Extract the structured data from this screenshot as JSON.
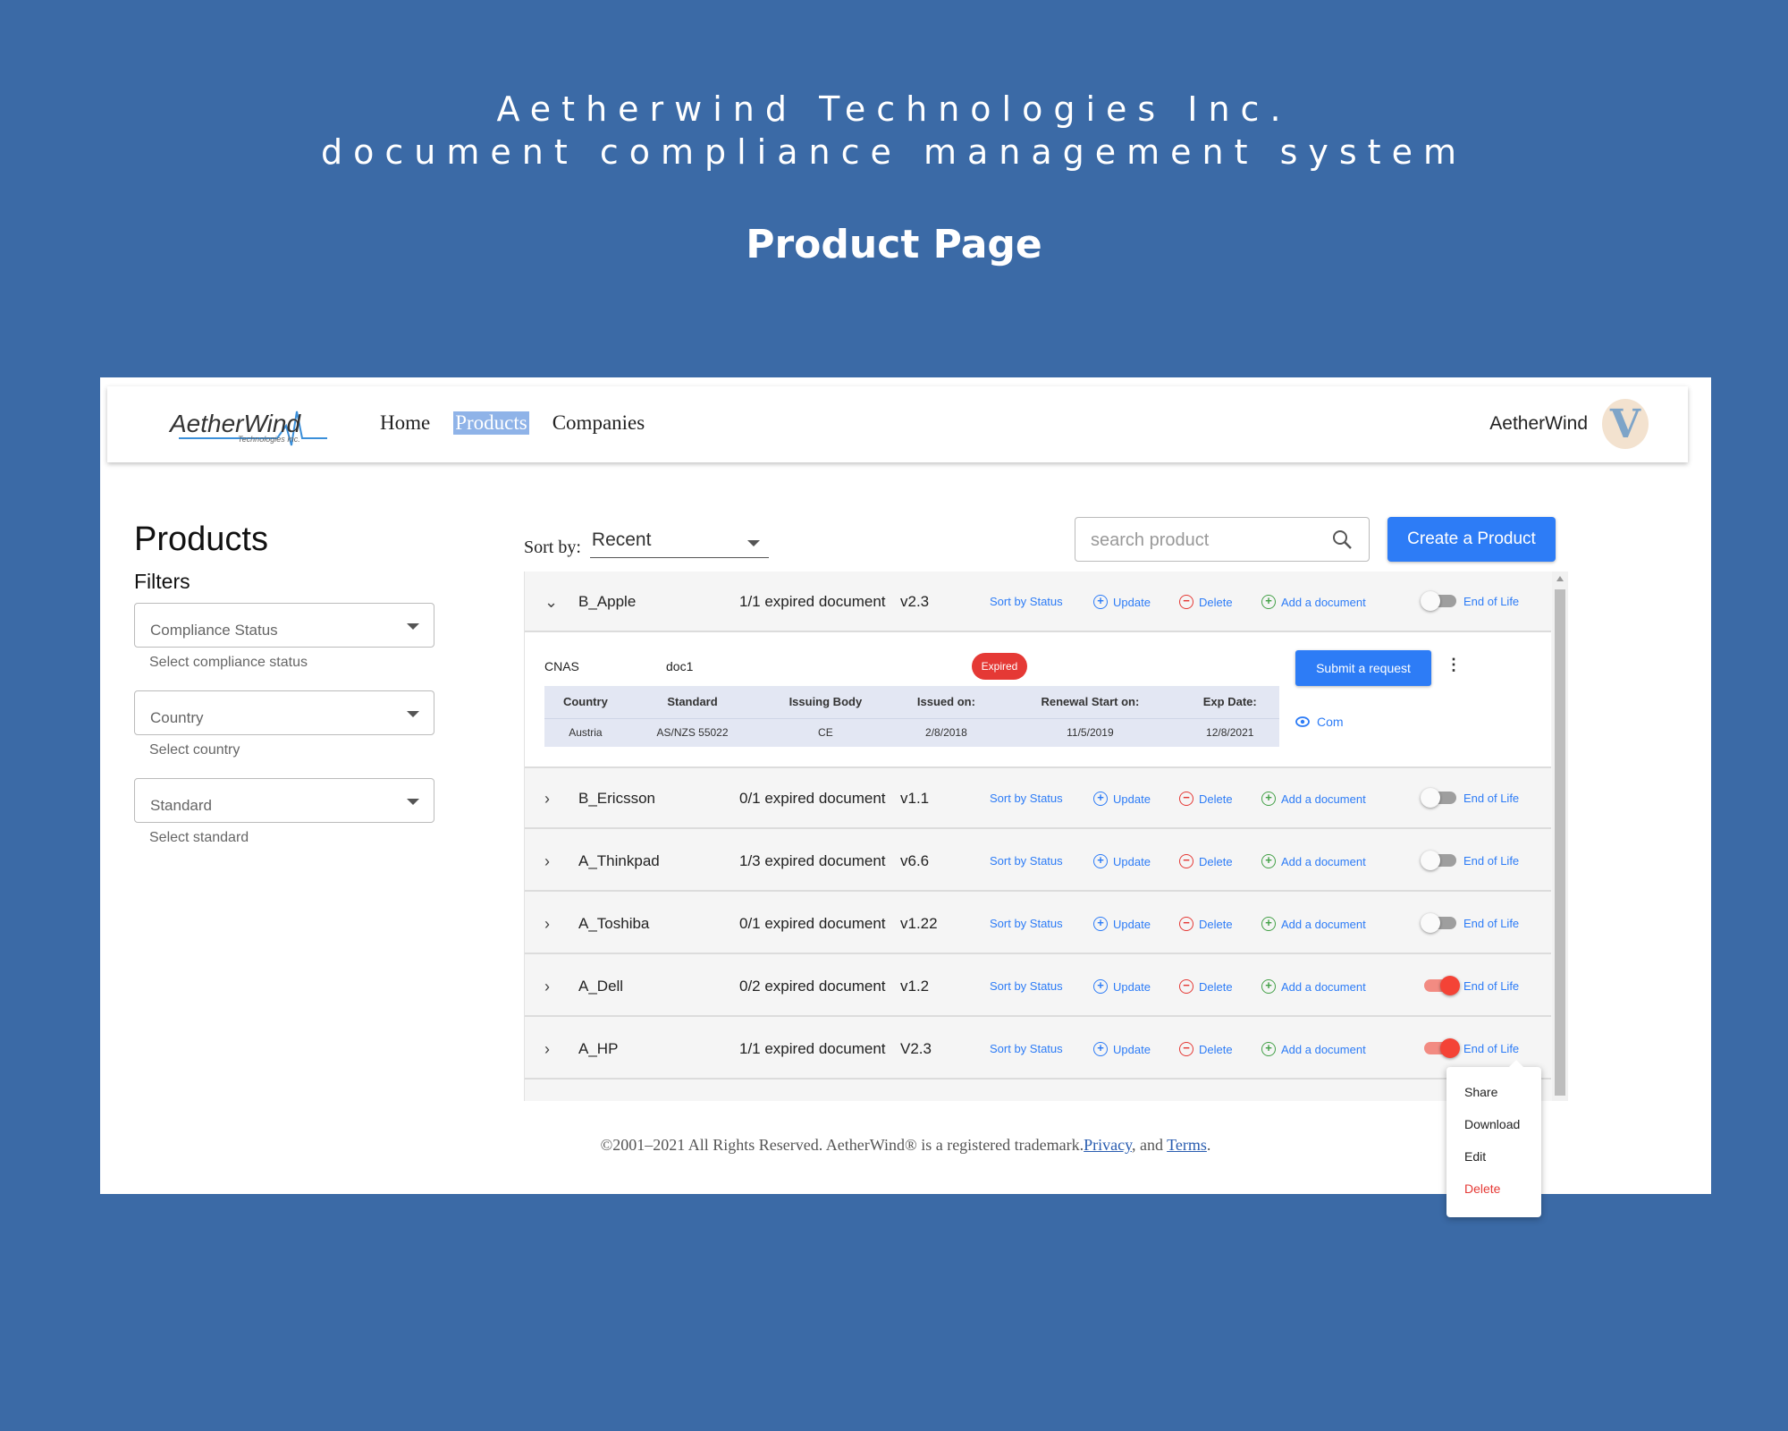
{
  "hero": {
    "company": "Aetherwind Technologies Inc.",
    "system": "document compliance management system",
    "page_title": "Product Page"
  },
  "nav": {
    "logo_text": "AetherWind",
    "logo_sub": "Technologies Inc.",
    "links": [
      "Home",
      "Products",
      "Companies"
    ],
    "active_link": "Products",
    "username": "AetherWind",
    "avatar_letter": "V"
  },
  "filters": {
    "heading": "Products",
    "title": "Filters",
    "compliance": {
      "label": "Compliance Status",
      "helper": "Select compliance status"
    },
    "country": {
      "label": "Country",
      "helper": "Select country"
    },
    "standard": {
      "label": "Standard",
      "helper": "Select standard"
    }
  },
  "toolbar": {
    "sort_label": "Sort by:",
    "sort_value": "Recent",
    "search_placeholder": "search product",
    "create_label": "Create a Product"
  },
  "row_actions": {
    "sort": "Sort by Status",
    "update": "Update",
    "delete": "Delete",
    "add": "Add a document",
    "eol": "End of Life"
  },
  "products": [
    {
      "name": "B_Apple",
      "expired": "1/1 expired document",
      "version": "v2.3",
      "end_of_life": false,
      "expanded": true
    },
    {
      "name": "B_Ericsson",
      "expired": "0/1 expired document",
      "version": "v1.1",
      "end_of_life": false
    },
    {
      "name": "A_Thinkpad",
      "expired": "1/3 expired document",
      "version": "v6.6",
      "end_of_life": false
    },
    {
      "name": "A_Toshiba",
      "expired": "0/1 expired document",
      "version": "v1.22",
      "end_of_life": false
    },
    {
      "name": "A_Dell",
      "expired": "0/2 expired document",
      "version": "v1.2",
      "end_of_life": true
    },
    {
      "name": "A_HP",
      "expired": "1/1 expired document",
      "version": "V2.3",
      "end_of_life": true
    }
  ],
  "expanded_doc": {
    "body": "CNAS",
    "doc": "doc1",
    "status": "Expired",
    "headers": [
      "Country",
      "Standard",
      "Issuing Body",
      "Issued on:",
      "Renewal Start on:",
      "Exp Date:"
    ],
    "values": [
      "Austria",
      "AS/NZS 55022",
      "CE",
      "2/8/2018",
      "11/5/2019",
      "12/8/2021"
    ],
    "submit_label": "Submit a request",
    "comments_label": "Com"
  },
  "menu": [
    "Share",
    "Download",
    "Edit",
    "Delete"
  ],
  "footer": {
    "text": "©2001–2021 All Rights Reserved. AetherWind® is a registered trademark.",
    "privacy": "Privacy",
    "and": ", and",
    "terms": "Terms",
    "end": "."
  },
  "colors": {
    "background": "#3b6aa6",
    "accent": "#2d7cf6",
    "danger": "#e53935"
  }
}
